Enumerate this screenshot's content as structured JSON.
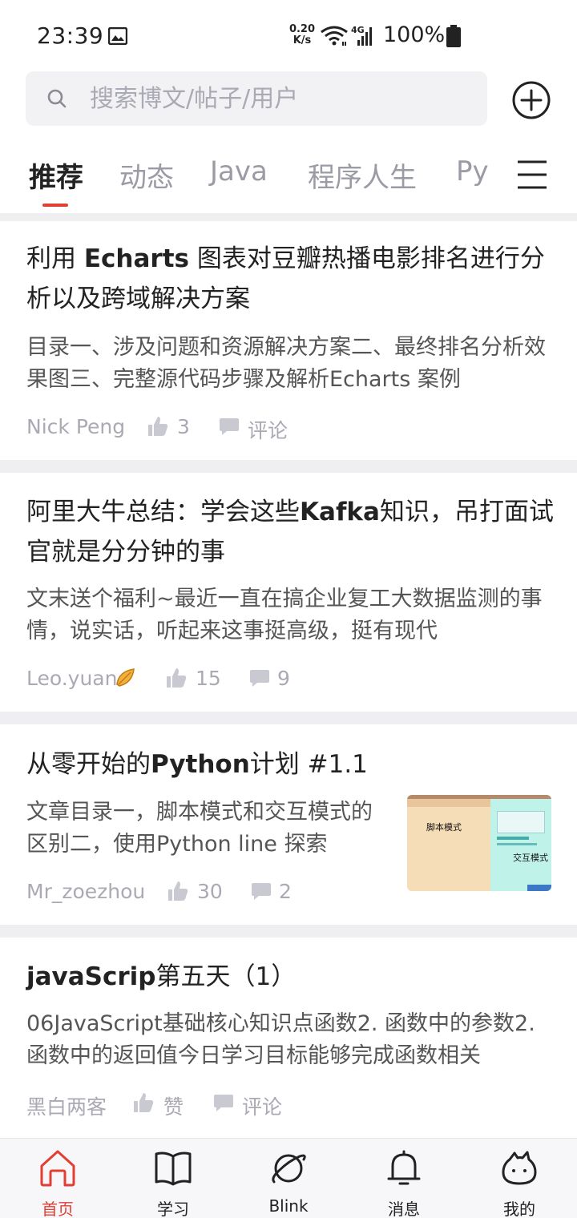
{
  "status_bar": {
    "time": "23:39",
    "net_speed_value": "0.20",
    "net_speed_unit": "K/s",
    "network_type": "4G",
    "battery": "100%"
  },
  "search": {
    "placeholder": "搜索博文/帖子/用户"
  },
  "tabs": [
    {
      "label": "推荐",
      "active": true
    },
    {
      "label": "动态"
    },
    {
      "label": "Java"
    },
    {
      "label": "程序人生"
    },
    {
      "label": "Py"
    }
  ],
  "articles": [
    {
      "title_pre": "利用 ",
      "title_bold": "Echarts",
      "title_post": " 图表对豆瓣热播电影排名进行分析以及跨域解决方案",
      "summary": "目录一、涉及问题和资源解决方案二、最终排名分析效果图三、完整源代码步骤及解析Echarts 案例",
      "author": "Nick Peng",
      "likes": "3",
      "comments": "评论"
    },
    {
      "title_pre": "阿里大牛总结：学会这些",
      "title_bold": "Kafka",
      "title_post": "知识，吊打面试官就是分分钟的事",
      "summary": "文末送个福利~最近一直在搞企业复工大数据监测的事情，说实话，听起来这事挺高级，挺有现代",
      "author": "Leo.yuan",
      "likes": "15",
      "comments": "9"
    },
    {
      "title_pre": "从零开始的",
      "title_bold": "Python",
      "title_post": "计划 #1.1",
      "summary": "文章目录一，脚本模式和交互模式的区别二，使用Python line 探索",
      "author": "Mr_zoezhou",
      "likes": "30",
      "comments": "2",
      "thumb_left_label": "脚本模式",
      "thumb_right_label": "交互模式"
    },
    {
      "title_bold": "javaScrip",
      "title_post": "第五天（1）",
      "summary": "06JavaScript基础核心知识点函数2. 函数中的参数2. 函数中的返回值今日学习目标能够完成函数相关",
      "author": "黑白两客",
      "likes": "赞",
      "comments": "评论"
    }
  ],
  "bottom_nav": [
    {
      "label": "首页",
      "icon": "home-icon",
      "active": true
    },
    {
      "label": "学习",
      "icon": "book-icon"
    },
    {
      "label": "Blink",
      "icon": "planet-icon"
    },
    {
      "label": "消息",
      "icon": "bell-icon"
    },
    {
      "label": "我的",
      "icon": "profile-icon"
    }
  ],
  "colors": {
    "accent": "#e33e33",
    "muted": "#a9aab3",
    "text": "#222222"
  }
}
